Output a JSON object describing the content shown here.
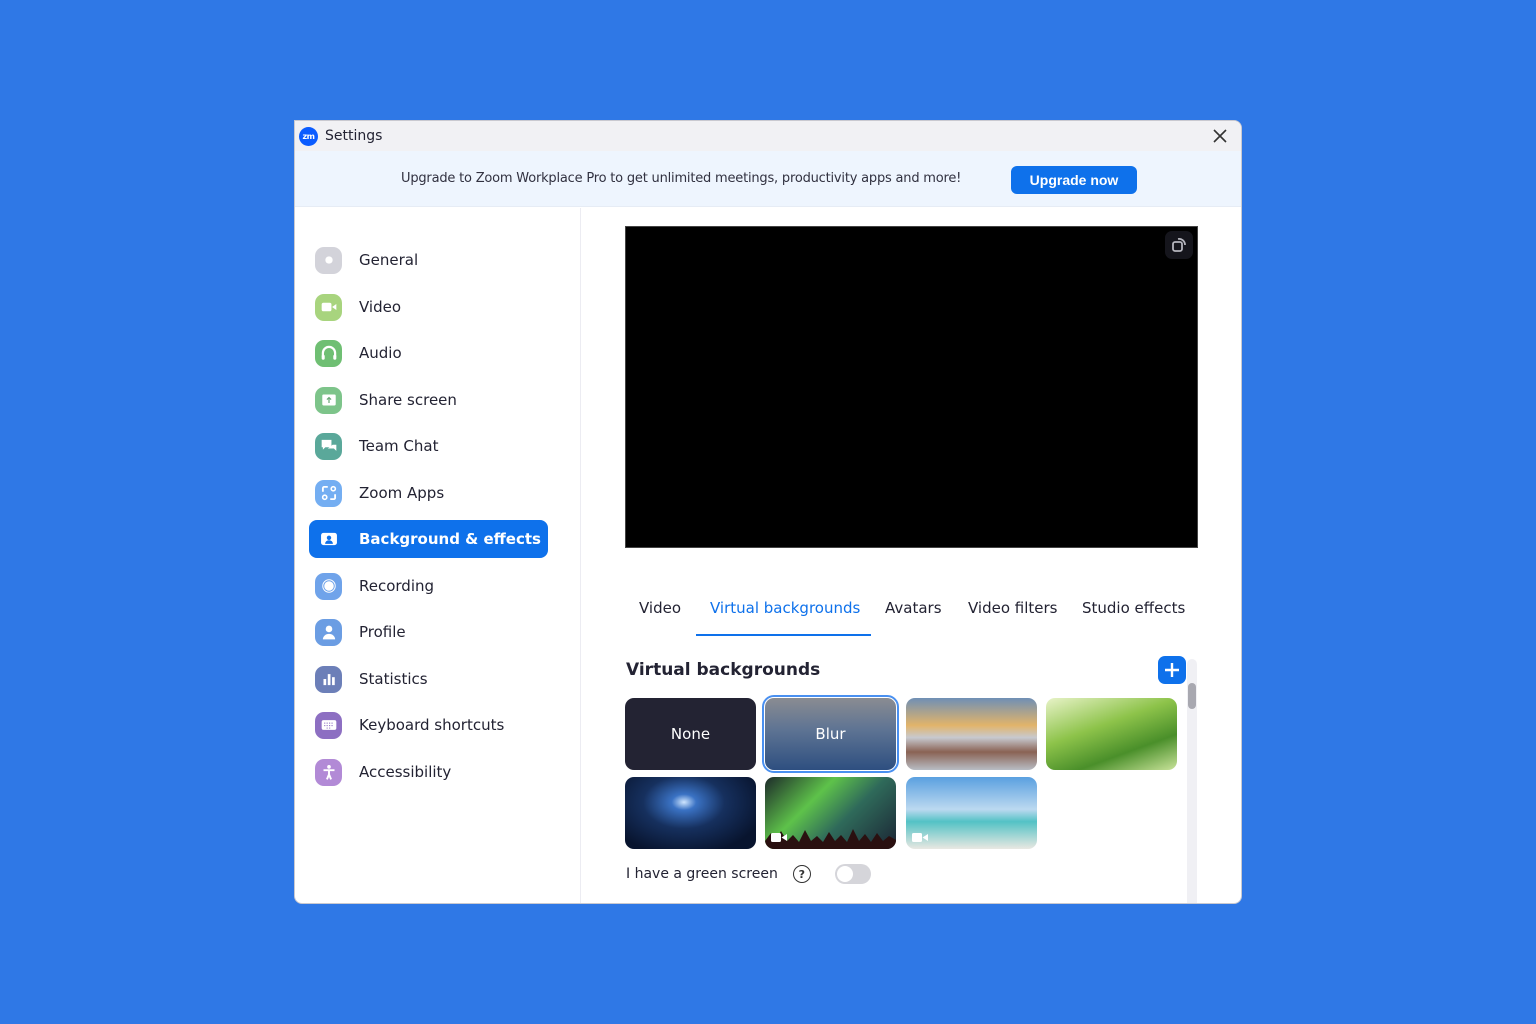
{
  "window": {
    "title": "Settings",
    "app_logo_text": "zm",
    "close_icon": "close-icon"
  },
  "banner": {
    "text": "Upgrade to Zoom Workplace Pro to get unlimited meetings, productivity apps and more!",
    "button_label": "Upgrade now"
  },
  "sidebar": {
    "active_index": 6,
    "items": [
      {
        "label": "General",
        "icon": "gear-icon",
        "color": "#d3d3da"
      },
      {
        "label": "Video",
        "icon": "video-camera-icon",
        "color": "#a8d47e"
      },
      {
        "label": "Audio",
        "icon": "headphones-icon",
        "color": "#6fbf73"
      },
      {
        "label": "Share screen",
        "icon": "share-screen-icon",
        "color": "#7dc48a"
      },
      {
        "label": "Team Chat",
        "icon": "chat-bubbles-icon",
        "color": "#5aa89a"
      },
      {
        "label": "Zoom Apps",
        "icon": "zoom-apps-icon",
        "color": "#74aef2"
      },
      {
        "label": "Background & effects",
        "icon": "background-effects-icon",
        "color": "#ffffff"
      },
      {
        "label": "Recording",
        "icon": "recording-icon",
        "color": "#6fa3ea"
      },
      {
        "label": "Profile",
        "icon": "profile-icon",
        "color": "#6b9de3"
      },
      {
        "label": "Statistics",
        "icon": "statistics-icon",
        "color": "#6c7fb8"
      },
      {
        "label": "Keyboard shortcuts",
        "icon": "keyboard-icon",
        "color": "#8d6fc2"
      },
      {
        "label": "Accessibility",
        "icon": "accessibility-icon",
        "color": "#b28ad6"
      }
    ]
  },
  "main": {
    "tabs": [
      {
        "label": "Video",
        "active": false
      },
      {
        "label": "Virtual backgrounds",
        "active": true
      },
      {
        "label": "Avatars",
        "active": false
      },
      {
        "label": "Video filters",
        "active": false
      },
      {
        "label": "Studio effects",
        "active": false
      }
    ],
    "section_title": "Virtual backgrounds",
    "add_button": "add-background-icon",
    "backgrounds": [
      {
        "label": "None",
        "kind": "none",
        "selected": false,
        "video": false
      },
      {
        "label": "Blur",
        "kind": "blur",
        "selected": true,
        "video": false
      },
      {
        "label": "",
        "kind": "golden-gate-bridge",
        "selected": false,
        "video": false
      },
      {
        "label": "",
        "kind": "grass",
        "selected": false,
        "video": false
      },
      {
        "label": "",
        "kind": "earth-from-space",
        "selected": false,
        "video": false
      },
      {
        "label": "",
        "kind": "northern-lights",
        "selected": false,
        "video": true
      },
      {
        "label": "",
        "kind": "beach-palm",
        "selected": false,
        "video": true
      }
    ],
    "green_screen": {
      "label": "I have a green screen",
      "help_glyph": "?",
      "enabled": false
    }
  },
  "colors": {
    "accent": "#0e71eb",
    "desktop_bg": "#2f78e6"
  }
}
